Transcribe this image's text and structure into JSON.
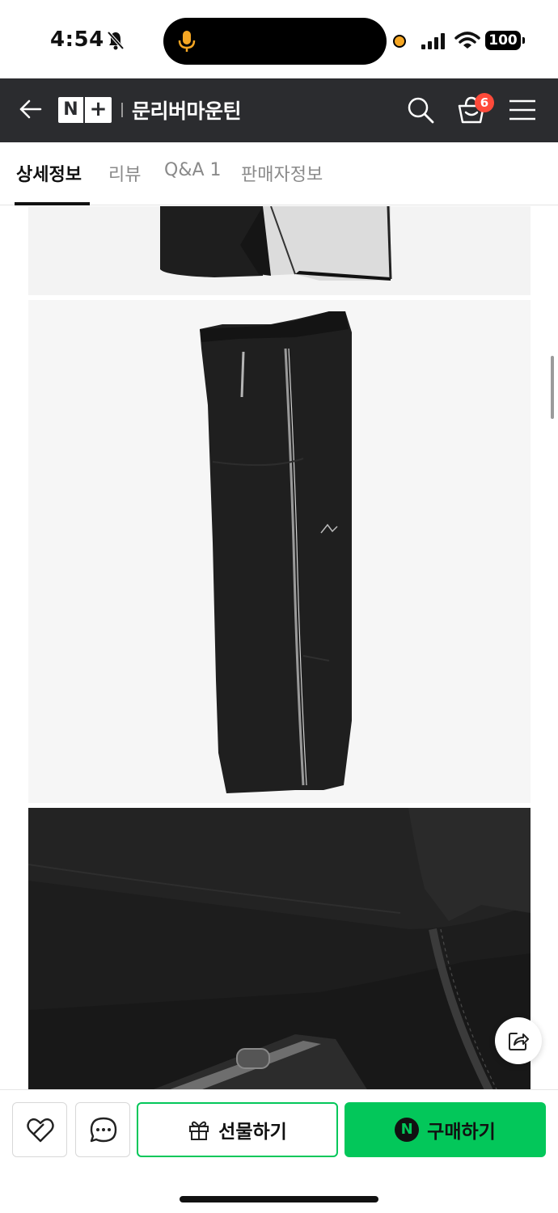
{
  "status_bar": {
    "time": "4:54",
    "battery": "100"
  },
  "header": {
    "store_name": "문리버마운틴",
    "cart_count": "6",
    "logo_n": "N",
    "logo_plus": "+"
  },
  "tabs": [
    {
      "label": "상세정보",
      "active": true
    },
    {
      "label": "리뷰",
      "active": false
    },
    {
      "label": "Q&A 1",
      "active": false
    },
    {
      "label": "판매자정보",
      "active": false
    }
  ],
  "bottom_bar": {
    "gift_label": "선물하기",
    "buy_label": "구매하기",
    "npay_letter": "N"
  },
  "colors": {
    "header_bg": "#2b2c2f",
    "accent_green": "#03c75a",
    "badge_red": "#ff4a3a"
  },
  "icons": [
    "back-arrow-icon",
    "search-icon",
    "shopping-bag-icon",
    "hamburger-menu-icon",
    "share-icon",
    "heart-icon",
    "chat-icon",
    "gift-icon"
  ]
}
